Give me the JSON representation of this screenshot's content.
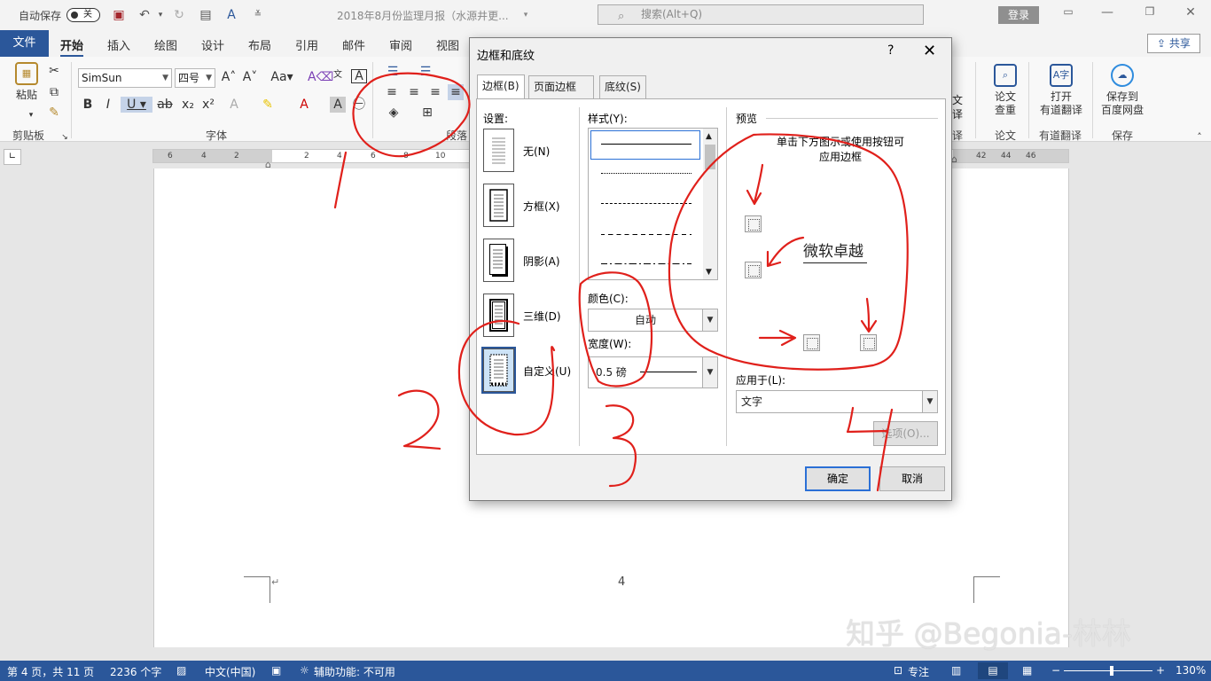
{
  "titlebar": {
    "autosave_label": "自动保存",
    "autosave_state": "关",
    "doc_title": "2018年8月份监理月报（水源井更...",
    "search_placeholder": "搜索(Alt+Q)",
    "login_label": "登录",
    "icons": [
      "save-icon",
      "undo-icon",
      "redo-icon",
      "print-preview-icon",
      "read-aloud-icon",
      "customize-icon"
    ]
  },
  "tabs": {
    "file": "文件",
    "items": [
      "开始",
      "插入",
      "绘图",
      "设计",
      "布局",
      "引用",
      "邮件",
      "审阅",
      "视图"
    ],
    "active": "开始",
    "share": "共享"
  },
  "ribbon": {
    "paste_label": "粘贴",
    "font_name": "SimSun",
    "font_size": "四号",
    "groups": {
      "clipboard": "剪贴板",
      "font": "字体",
      "paragraph": "段落"
    },
    "right_buttons": [
      {
        "label": "论文",
        "sub": "查重",
        "group": "论文"
      },
      {
        "label": "打开",
        "sub": "有道翻译",
        "group": "有道翻译"
      },
      {
        "label": "保存到",
        "sub": "百度网盘",
        "group": "保存"
      }
    ],
    "partial_labels": {
      "translate_top": "文",
      "translate_sub": "译",
      "translate_group": "译",
      "paragraph_partial": "段落"
    }
  },
  "ruler": {
    "left_numbers": [
      "6",
      "4",
      "2",
      "2",
      "4",
      "6",
      "8",
      "10"
    ],
    "right_numbers": [
      "42",
      "44",
      "46"
    ]
  },
  "document": {
    "page_number": "4",
    "paragraph_mark": "↵"
  },
  "dialog": {
    "title": "边框和底纹",
    "help": "?",
    "close": "✕",
    "tabs": [
      "边框(B)",
      "页面边框(P)",
      "底纹(S)"
    ],
    "active_tab": "边框(B)",
    "settings_label": "设置:",
    "settings": [
      {
        "label": "无(N)",
        "selected": false
      },
      {
        "label": "方框(X)",
        "selected": false
      },
      {
        "label": "阴影(A)",
        "selected": false
      },
      {
        "label": "三维(D)",
        "selected": false
      },
      {
        "label": "自定义(U)",
        "selected": true
      }
    ],
    "style_label": "样式(Y):",
    "styles": [
      "solid",
      "dotted",
      "dashed-small",
      "dashed",
      "dash-dot"
    ],
    "color_label": "颜色(C):",
    "color_value": "自动",
    "width_label": "宽度(W):",
    "width_value": "0.5 磅",
    "preview_label": "预览",
    "preview_hint_1": "单击下方图示或使用按钮可",
    "preview_hint_2": "应用边框",
    "preview_sample": "微软卓越",
    "apply_label": "应用于(L):",
    "apply_value": "文字",
    "options_button": "选项(O)...",
    "ok_button": "确定",
    "cancel_button": "取消"
  },
  "status": {
    "page": "第 4 页，共 11 页",
    "words": "2236 个字",
    "language": "中文(中国)",
    "accessibility": "辅助功能: 不可用",
    "focus": "专注",
    "zoom": "130%",
    "zoom_fraction": 0.52
  },
  "annotations": {
    "numbers": [
      "1",
      "2",
      "3"
    ]
  },
  "watermark": "知乎 @Begonia-林林",
  "colors": {
    "accent": "#2b579a",
    "annotation": "#e0201b"
  }
}
